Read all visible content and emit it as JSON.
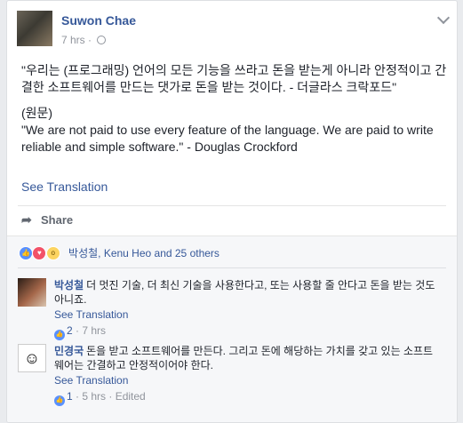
{
  "post": {
    "author": "Suwon Chae",
    "time": "7 hrs",
    "dot": "·",
    "paragraph1": "\"우리는 (프로그래밍) 언어의 모든 기능을 쓰라고 돈을 받는게 아니라 안정적이고 간결한 소프트웨어를 만드는 댓가로 돈을 받는 것이다. - 더글라스 크락포드\"",
    "original_label": "(원문)",
    "paragraph2": "\"We are not paid to use every feature of the language. We are paid to write reliable and simple software.\" - Douglas Crockford",
    "see_translation": "See Translation",
    "share_label": "Share"
  },
  "reactions": {
    "text": "박성철, Kenu Heo and 25 others"
  },
  "comments": [
    {
      "name": "박성철",
      "text": "더 멋진 기술, 더 최신 기술을 사용한다고, 또는 사용할 줄 안다고 돈을 받는 것도 아니죠.",
      "see_translation": "See Translation",
      "likes": "2",
      "meta": "· 7 hrs"
    },
    {
      "name": "민경국",
      "text": "돈을 받고 소프트웨어를 만든다. 그리고 돈에 해당하는 가치를 갖고 있는 소프트웨어는 간결하고 안정적이어야 한다.",
      "see_translation": "See Translation",
      "likes": "1",
      "meta": "· 5 hrs · Edited"
    }
  ],
  "colors": {
    "link": "#365899",
    "like": "#5890ff",
    "love": "#f25268",
    "wow": "#fcd460"
  }
}
